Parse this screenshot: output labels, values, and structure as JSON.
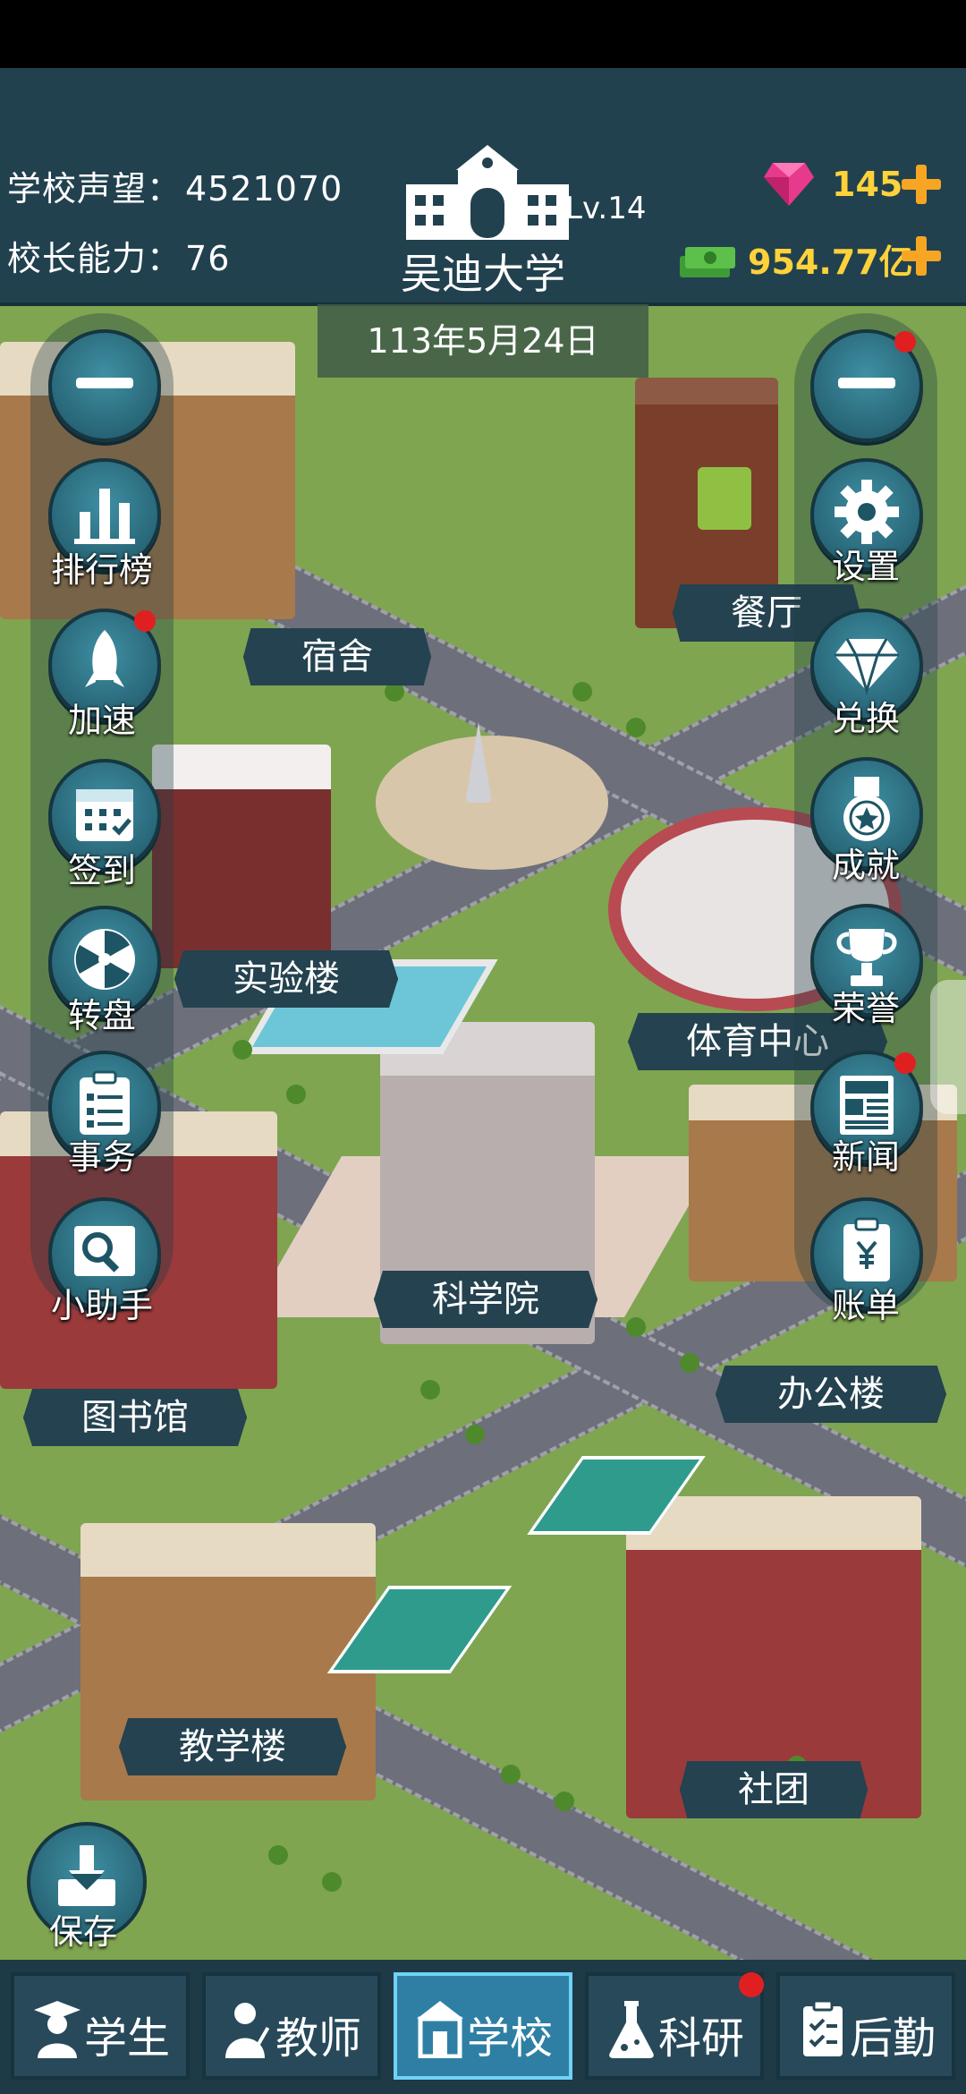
{
  "header": {
    "reputation_label": "学校声望：",
    "reputation_value": "4521070",
    "principal_label": "校长能力：",
    "principal_value": "76",
    "school_name": "吴迪大学",
    "level": "Lv.14",
    "gems": "145",
    "money": "954.77亿",
    "date": "113年5月24日"
  },
  "left_menu": {
    "items": [
      {
        "label": "排行榜",
        "icon": "bar-chart-icon"
      },
      {
        "label": "加速",
        "icon": "rocket-icon"
      },
      {
        "label": "签到",
        "icon": "calendar-icon"
      },
      {
        "label": "转盘",
        "icon": "wheel-icon"
      },
      {
        "label": "事务",
        "icon": "clipboard-icon"
      },
      {
        "label": "小助手",
        "icon": "magnifier-icon"
      }
    ]
  },
  "right_menu": {
    "items": [
      {
        "label": "设置",
        "icon": "gear-icon"
      },
      {
        "label": "兑换",
        "icon": "diamond-icon"
      },
      {
        "label": "成就",
        "icon": "medal-icon"
      },
      {
        "label": "荣誉",
        "icon": "trophy-icon"
      },
      {
        "label": "新闻",
        "icon": "newspaper-icon"
      },
      {
        "label": "账单",
        "icon": "bill-icon"
      }
    ]
  },
  "buildings": {
    "dorm": "宿舍",
    "canteen": "餐厅",
    "lab": "实验楼",
    "sports": "体育中心",
    "science": "科学院",
    "library": "图书馆",
    "office": "办公楼",
    "teaching": "教学楼",
    "club": "社团"
  },
  "save_label": "保存",
  "bottom_nav": {
    "tabs": [
      {
        "label": "学生",
        "icon": "student-icon"
      },
      {
        "label": "教师",
        "icon": "teacher-icon"
      },
      {
        "label": "学校",
        "icon": "school-icon"
      },
      {
        "label": "科研",
        "icon": "flask-icon"
      },
      {
        "label": "后勤",
        "icon": "clipboard-check-icon"
      }
    ],
    "active_tab": "学校"
  },
  "colors": {
    "topbar": "#22414f",
    "grass": "#7fa550",
    "plate": "#24424f",
    "gold": "#ffd23a",
    "gem": "#e83a8c",
    "badge_dot": "#e02020"
  }
}
